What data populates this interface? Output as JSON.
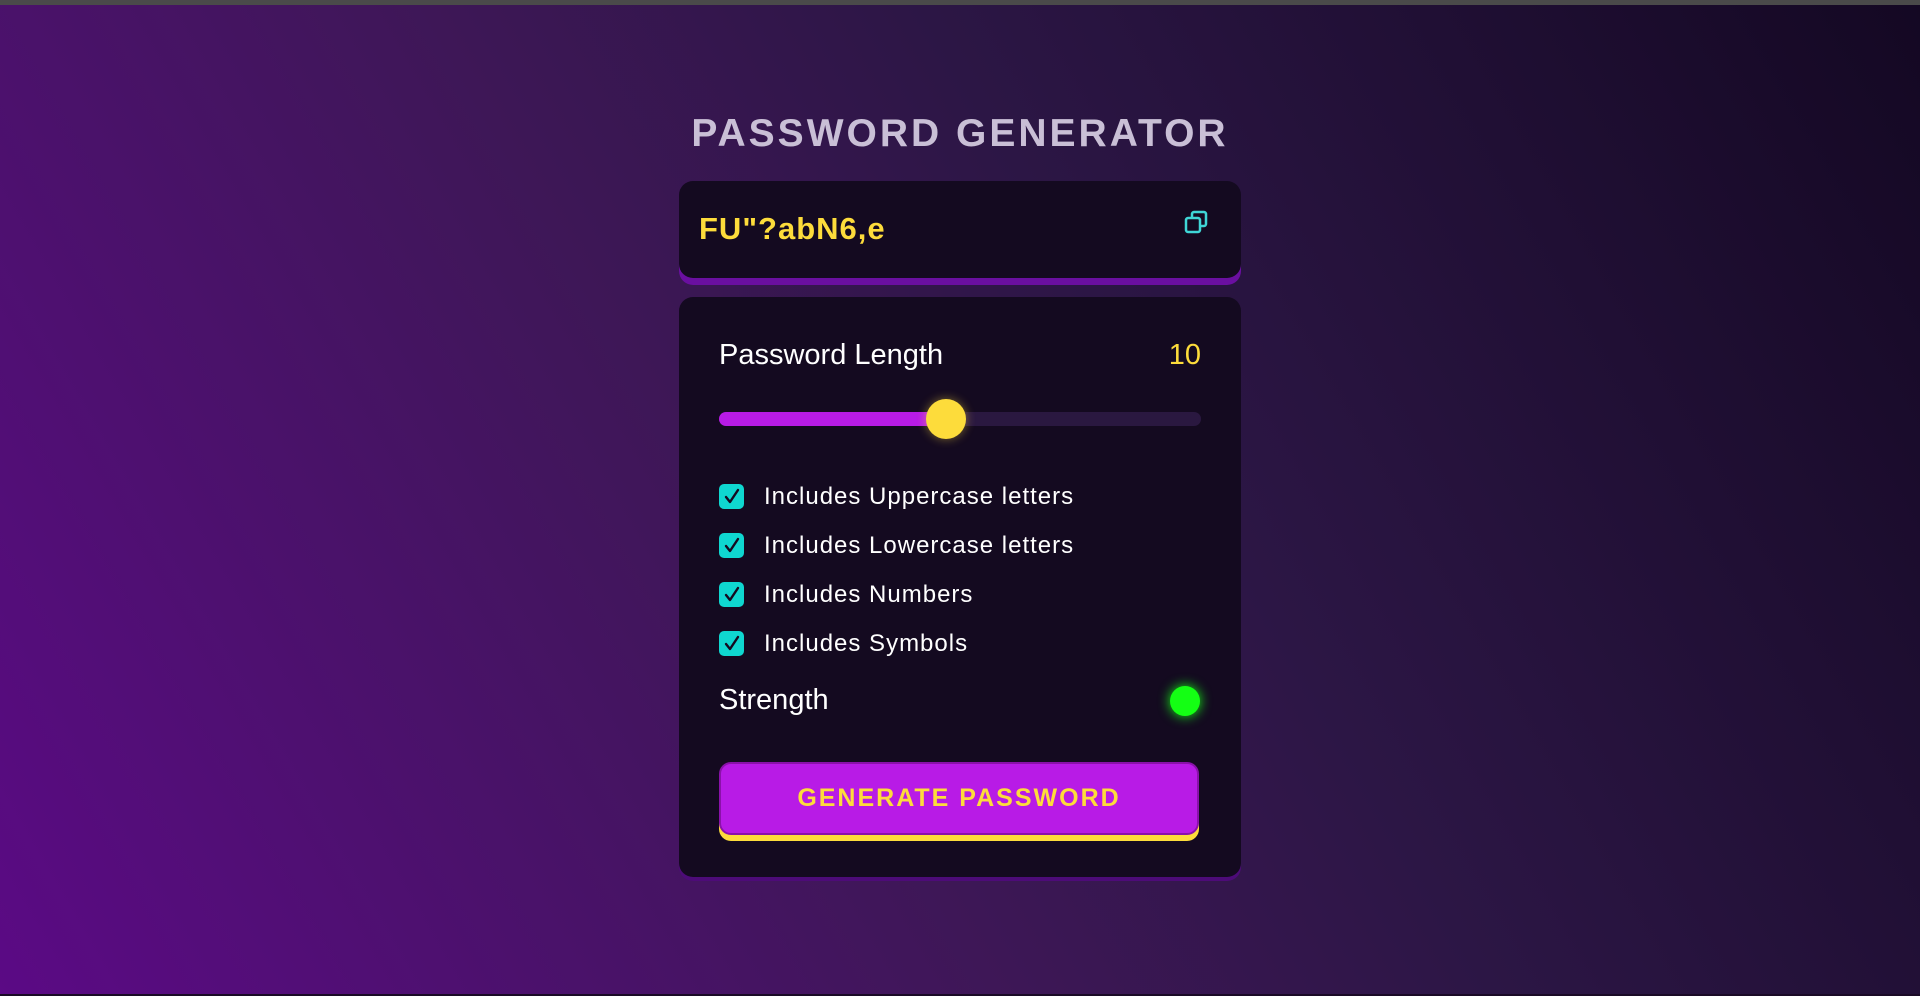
{
  "app": {
    "title": "PASSWORD GENERATOR"
  },
  "display": {
    "password": "FU\"?abN6,e",
    "copy_icon": "copy-icon"
  },
  "length": {
    "label": "Password Length",
    "value": "10",
    "slider_fraction": 0.47
  },
  "options": [
    {
      "label": "Includes Uppercase letters",
      "checked": true
    },
    {
      "label": "Includes Lowercase letters",
      "checked": true
    },
    {
      "label": "Includes Numbers",
      "checked": true
    },
    {
      "label": "Includes Symbols",
      "checked": true
    }
  ],
  "strength": {
    "label": "Strength",
    "indicator_color": "#14ff14"
  },
  "generate": {
    "label": "GENERATE PASSWORD"
  },
  "colors": {
    "accent_yellow": "#fddc3b",
    "accent_purple": "#b81be6",
    "checkbox_teal": "#0fd7d0",
    "panel_bg": "#140a20"
  }
}
